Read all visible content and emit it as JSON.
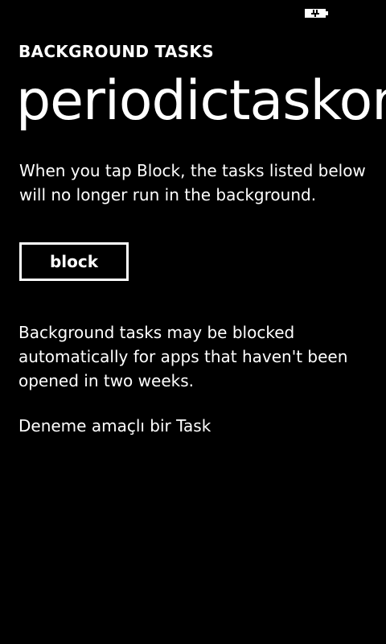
{
  "status_bar": {
    "icons": [
      "battery-charging-icon"
    ]
  },
  "header": {
    "app_title": "BACKGROUND TASKS",
    "page_title": "periodictaskorn"
  },
  "main": {
    "intro_text": "When you tap Block, the tasks listed below will no longer run in the background.",
    "block_button_label": "block",
    "note_text": "Background tasks may be blocked automatically for apps that haven't been opened in two weeks.",
    "tasks": [
      {
        "label": "Deneme amaçlı bir Task"
      }
    ]
  },
  "colors": {
    "background": "#000000",
    "foreground": "#ffffff"
  }
}
